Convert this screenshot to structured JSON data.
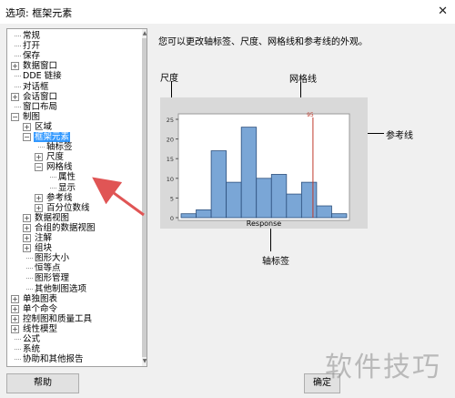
{
  "window": {
    "title": "选项: 框架元素",
    "close_glyph": "✕"
  },
  "tree": {
    "items": [
      {
        "label": "常规",
        "level": 0,
        "expander": ""
      },
      {
        "label": "打开",
        "level": 0,
        "expander": ""
      },
      {
        "label": "保存",
        "level": 0,
        "expander": ""
      },
      {
        "label": "数据窗口",
        "level": 0,
        "expander": "+"
      },
      {
        "label": "DDE 链接",
        "level": 0,
        "expander": ""
      },
      {
        "label": "对话框",
        "level": 0,
        "expander": ""
      },
      {
        "label": "会话窗口",
        "level": 0,
        "expander": "+"
      },
      {
        "label": "窗口布局",
        "level": 0,
        "expander": ""
      },
      {
        "label": "制图",
        "level": 0,
        "expander": "−"
      },
      {
        "label": "区域",
        "level": 1,
        "expander": "+"
      },
      {
        "label": "框架元素",
        "level": 1,
        "expander": "−",
        "selected": true
      },
      {
        "label": "轴标签",
        "level": 2,
        "expander": ""
      },
      {
        "label": "尺度",
        "level": 2,
        "expander": "+"
      },
      {
        "label": "网格线",
        "level": 2,
        "expander": "−"
      },
      {
        "label": "属性",
        "level": 3,
        "expander": ""
      },
      {
        "label": "显示",
        "level": 3,
        "expander": ""
      },
      {
        "label": "参考线",
        "level": 2,
        "expander": "+"
      },
      {
        "label": "百分位数线",
        "level": 2,
        "expander": "+"
      },
      {
        "label": "数据视图",
        "level": 1,
        "expander": "+"
      },
      {
        "label": "合组的数据视图",
        "level": 1,
        "expander": "+"
      },
      {
        "label": "注解",
        "level": 1,
        "expander": "+"
      },
      {
        "label": "组块",
        "level": 1,
        "expander": "+"
      },
      {
        "label": "图形大小",
        "level": 1,
        "expander": ""
      },
      {
        "label": "恒等点",
        "level": 1,
        "expander": ""
      },
      {
        "label": "图形管理",
        "level": 1,
        "expander": ""
      },
      {
        "label": "其他制图选项",
        "level": 1,
        "expander": ""
      },
      {
        "label": "单独图表",
        "level": 0,
        "expander": "+"
      },
      {
        "label": "单个命令",
        "level": 0,
        "expander": "+"
      },
      {
        "label": "控制图和质量工具",
        "level": 0,
        "expander": "+"
      },
      {
        "label": "线性模型",
        "level": 0,
        "expander": "+"
      },
      {
        "label": "公式",
        "level": 0,
        "expander": ""
      },
      {
        "label": "系统",
        "level": 0,
        "expander": ""
      },
      {
        "label": "协助和其他报告",
        "level": 0,
        "expander": ""
      }
    ]
  },
  "main": {
    "description": "您可以更改轴标签、尺度、网格线和参考线的外观。",
    "callouts": {
      "scale": "尺度",
      "gridlines": "网格线",
      "reference_line": "参考线",
      "axis_label": "轴标签"
    }
  },
  "chart_data": {
    "type": "bar",
    "x_label": "Response",
    "y_ticks": [
      "0",
      "5",
      "10",
      "15",
      "20",
      "25"
    ],
    "ylim": [
      0,
      25
    ],
    "values": [
      1,
      2,
      17,
      9,
      23,
      10,
      11,
      6,
      9,
      3,
      1
    ],
    "reference_line": {
      "label": "95"
    },
    "bar_color": "#7aa6d6",
    "ref_color": "#c0392b"
  },
  "buttons": {
    "help": "帮助",
    "ok": "确定"
  },
  "watermark": "软件技巧",
  "colors": {
    "selection": "#3399ff",
    "arrow": "#e05555"
  }
}
